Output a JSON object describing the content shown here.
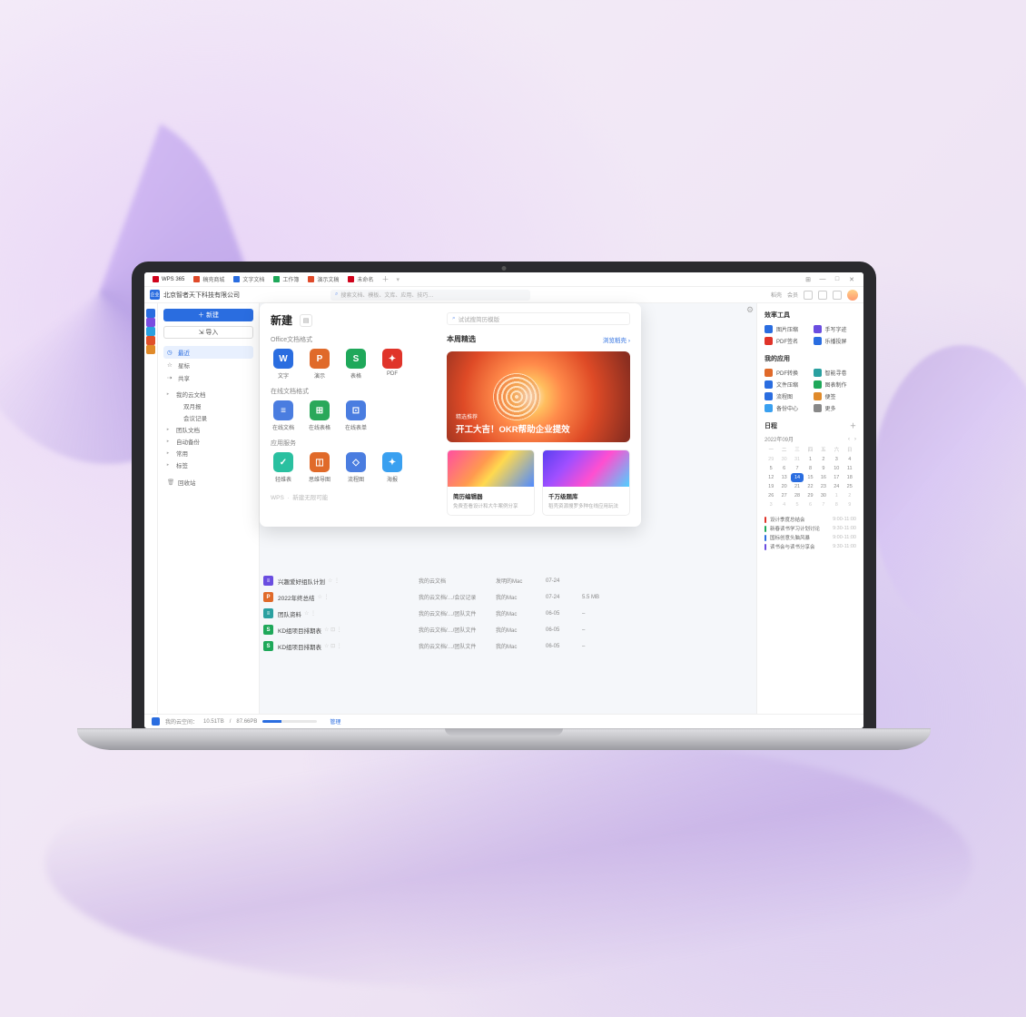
{
  "tabs": [
    {
      "icon_color": "#d0021b",
      "label": "WPS 365"
    },
    {
      "icon_color": "#e04a2a",
      "label": "稿壳商城"
    },
    {
      "icon_color": "#2a6de0",
      "label": "文字文档"
    },
    {
      "icon_color": "#1fa85a",
      "label": "工作簿"
    },
    {
      "icon_color": "#e04a2a",
      "label": "演示文稿"
    },
    {
      "icon_color": "#d0021b",
      "label": "未命名"
    }
  ],
  "window_controls": {
    "grid": "⊞",
    "min": "—",
    "max": "□",
    "close": "✕"
  },
  "org": {
    "badge": "企业",
    "name": "北京智者天下科技有限公司"
  },
  "search_main": {
    "placeholder": "搜索文档、模板、文库、应用、技巧…"
  },
  "topbar_links": [
    "稻壳",
    "会员"
  ],
  "leftbar_colors": [
    "#2a6de0",
    "#7a4de0",
    "#2aa0e0",
    "#e0502a",
    "#e08a2a"
  ],
  "sidebar": {
    "new_label": "＋ 新建",
    "import_label": "⇲ 导入",
    "quick": [
      {
        "id": "recent",
        "icon": "◷",
        "label": "最近",
        "active": true
      },
      {
        "id": "star",
        "icon": "☆",
        "label": "星标"
      },
      {
        "id": "share",
        "icon": "⇢",
        "label": "共享"
      }
    ],
    "tree": [
      {
        "label": "我的云文档",
        "icon_color": "#2a6de0",
        "children": [
          {
            "label": "双月报",
            "icon": "folder"
          },
          {
            "label": "会议记录",
            "icon": "folder"
          }
        ]
      },
      {
        "label": "团队文档"
      },
      {
        "label": "自动备份"
      },
      {
        "label": "常用"
      },
      {
        "label": "标签"
      }
    ],
    "trash": "回收站"
  },
  "new_panel": {
    "title": "新建",
    "search_placeholder": "试试搜简历模版",
    "sections": [
      {
        "title": "Office文档格式",
        "items": [
          {
            "glyph": "W",
            "color": "#2a6de0",
            "label": "文字"
          },
          {
            "glyph": "P",
            "color": "#e06a2a",
            "label": "演示"
          },
          {
            "glyph": "S",
            "color": "#1fa85a",
            "label": "表格"
          },
          {
            "glyph": "✦",
            "color": "#e0342a",
            "label": "PDF"
          }
        ]
      },
      {
        "title": "在线文档格式",
        "items": [
          {
            "glyph": "≡",
            "color": "#4a7de0",
            "label": "在线文档"
          },
          {
            "glyph": "⊞",
            "color": "#2aa85a",
            "label": "在线表格"
          },
          {
            "glyph": "⊡",
            "color": "#4a7de0",
            "label": "在线表单"
          }
        ]
      },
      {
        "title": "应用服务",
        "items": [
          {
            "glyph": "✓",
            "color": "#2ac0a0",
            "label": "轻维表"
          },
          {
            "glyph": "◫",
            "color": "#e06a2a",
            "label": "思维导图"
          },
          {
            "glyph": "◇",
            "color": "#4a7de0",
            "label": "流程图"
          },
          {
            "glyph": "✦",
            "color": "#3aa0f0",
            "label": "海报"
          }
        ]
      }
    ],
    "footer_brand": "WPS",
    "footer_text": "新建无限可能",
    "featured": {
      "title": "本周精选",
      "link": "浏览稻壳 ›",
      "banner": {
        "kicker": "精选推荐",
        "headline": "开工大吉！OKR帮助企业提效"
      },
      "cards": [
        {
          "title": "简历编辑器",
          "sub": "免费查看设计和大牛案例分享"
        },
        {
          "title": "千万级题库",
          "sub": "稻壳资源搜罗多种在线应用玩法"
        }
      ]
    }
  },
  "files": [
    {
      "type": "#6a4de0",
      "glyph": "≡",
      "name": "兴趣爱好组队计划",
      "flags": "☆ ⋮",
      "path": "我的云文档",
      "where": "发明的Mac",
      "date": "07-24",
      "size": ""
    },
    {
      "type": "#e06a2a",
      "glyph": "P",
      "name": "2022年终总结",
      "flags": "☆ ⋮",
      "path": "我的云文档/…/会议记录",
      "where": "我的Mac",
      "date": "07-24",
      "size": "5.5 MB"
    },
    {
      "type": "#2aa0a0",
      "glyph": "≡",
      "name": "团队资料",
      "flags": "☆ ⋮",
      "path": "我的云文档/…/团队文件",
      "where": "我的Mac",
      "date": "06-05",
      "size": "–"
    },
    {
      "type": "#1fa85a",
      "glyph": "S",
      "name": "KD组项目排期表",
      "flags": "☆ ⊡ ⋮",
      "path": "我的云文档/…/团队文件",
      "where": "我的Mac",
      "date": "06-05",
      "size": "–"
    },
    {
      "type": "#1fa85a",
      "glyph": "S",
      "name": "KD组项目排期表",
      "flags": "☆ ⊡ ⋮",
      "path": "我的云文档/…/团队文件",
      "where": "我的Mac",
      "date": "06-05",
      "size": "–"
    }
  ],
  "rightbar": {
    "tools_title": "效率工具",
    "tools": [
      {
        "c": "#2a6de0",
        "label": "图片压缩"
      },
      {
        "c": "#6a4de0",
        "label": "手写字迹"
      },
      {
        "c": "#e0342a",
        "label": "PDF签名"
      },
      {
        "c": "#2a6de0",
        "label": "乐播投屏"
      }
    ],
    "apps_title": "我的应用",
    "apps": [
      {
        "c": "#e06a2a",
        "label": "PDF转换"
      },
      {
        "c": "#2aa0a0",
        "label": "智能寻卷"
      },
      {
        "c": "#2a6de0",
        "label": "文件压缩"
      },
      {
        "c": "#1fa85a",
        "label": "图表制作"
      },
      {
        "c": "#2a6de0",
        "label": "流程图"
      },
      {
        "c": "#e08a2a",
        "label": "便签"
      },
      {
        "c": "#3aa0f0",
        "label": "备份中心"
      },
      {
        "c": "#888",
        "label": "更多"
      }
    ],
    "schedule_title": "日程",
    "calendar": {
      "month": "2022年09月",
      "weekdays": [
        "一",
        "二",
        "三",
        "四",
        "五",
        "六",
        "日"
      ],
      "rows": [
        [
          "29",
          "30",
          "31",
          "1",
          "2",
          "3",
          "4"
        ],
        [
          "5",
          "6",
          "7",
          "8",
          "9",
          "10",
          "11"
        ],
        [
          "12",
          "13",
          "14",
          "15",
          "16",
          "17",
          "18"
        ],
        [
          "19",
          "20",
          "21",
          "22",
          "23",
          "24",
          "25"
        ],
        [
          "26",
          "27",
          "28",
          "29",
          "30",
          "1",
          "2"
        ],
        [
          "3",
          "4",
          "5",
          "6",
          "7",
          "8",
          "9"
        ]
      ],
      "muted_first": 3,
      "muted_last_from": [
        5,
        2
      ],
      "today": [
        2,
        2
      ]
    },
    "events": [
      {
        "c": "#e0342a",
        "title": "设计季度总结会",
        "time": "9:00-11:00"
      },
      {
        "c": "#1fa85a",
        "title": "新春读书学习计划讨论",
        "time": "9:30-11:00"
      },
      {
        "c": "#2a6de0",
        "title": "国标创意头脑风暴",
        "time": "9:00-11:00"
      },
      {
        "c": "#6a4de0",
        "title": "读书会与读书分享会",
        "time": "9:30-11:00"
      }
    ]
  },
  "statusbar": {
    "label": "我的云空间：",
    "used": "10.51TB",
    "total": "87.66PB",
    "link": "管理"
  }
}
